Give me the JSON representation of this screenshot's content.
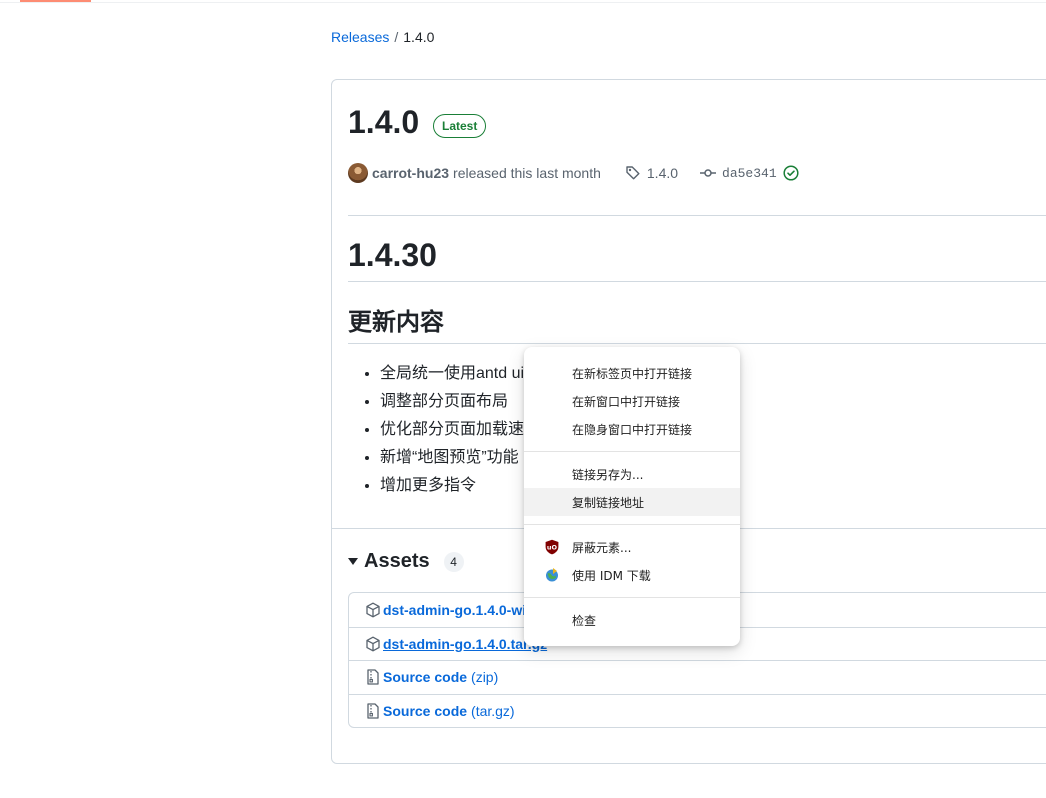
{
  "breadcrumb": {
    "releases": "Releases",
    "separator": "/",
    "current": "1.4.0"
  },
  "release": {
    "title": "1.4.0",
    "badge": "Latest",
    "author": "carrot-hu23",
    "released_text": "released this last month",
    "tag": "1.4.0",
    "commit": "da5e341"
  },
  "notes": {
    "version_heading": "1.4.30",
    "section_heading": "更新内容",
    "items": [
      "全局统一使用antd ui",
      "调整部分页面布局",
      "优化部分页面加载速",
      "新增“地图预览”功能",
      "增加更多指令"
    ]
  },
  "assets": {
    "heading": "Assets",
    "count": "4",
    "items": [
      {
        "name": "dst-admin-go.1.4.0-wir",
        "suffix": ""
      },
      {
        "name": "dst-admin-go.1.4.0.tar.gz",
        "suffix": ""
      },
      {
        "name": "Source code",
        "suffix": "(zip)"
      },
      {
        "name": "Source code",
        "suffix": "(tar.gz)"
      }
    ]
  },
  "context_menu": {
    "items": [
      "在新标签页中打开链接",
      "在新窗口中打开链接",
      "在隐身窗口中打开链接",
      "链接另存为...",
      "复制链接地址",
      "屏蔽元素...",
      "使用 IDM 下载",
      "检查"
    ],
    "icons": {
      "block_element": "ublock-shield-icon",
      "idm": "idm-globe-icon"
    }
  },
  "colors": {
    "link": "#0969da",
    "success": "#1a7f37",
    "tab_accent": "#fd8c73",
    "menu_hover": "#f2f2f2"
  }
}
